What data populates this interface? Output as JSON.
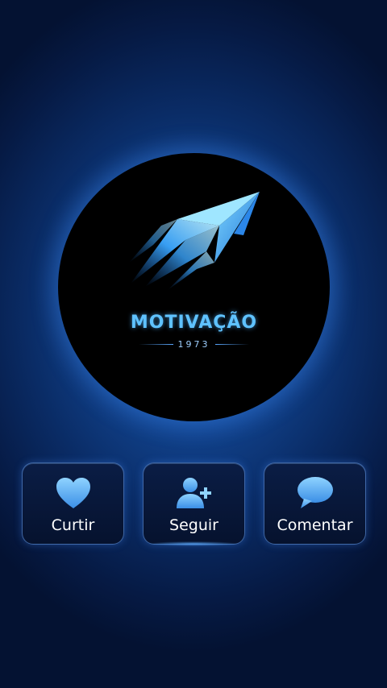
{
  "logo": {
    "brand_name": "MOTIVAÇÃO",
    "year": "1973",
    "icon": "rocket-arrow-icon"
  },
  "actions": [
    {
      "id": "like",
      "label": "Curtir",
      "icon": "heart-icon"
    },
    {
      "id": "follow",
      "label": "Seguir",
      "icon": "add-user-icon"
    },
    {
      "id": "comment",
      "label": "Comentar",
      "icon": "speech-bubble-icon"
    }
  ],
  "colors": {
    "background": "#0a2c66",
    "accent": "#5fc2ff",
    "button_border": "#6eaaff"
  }
}
